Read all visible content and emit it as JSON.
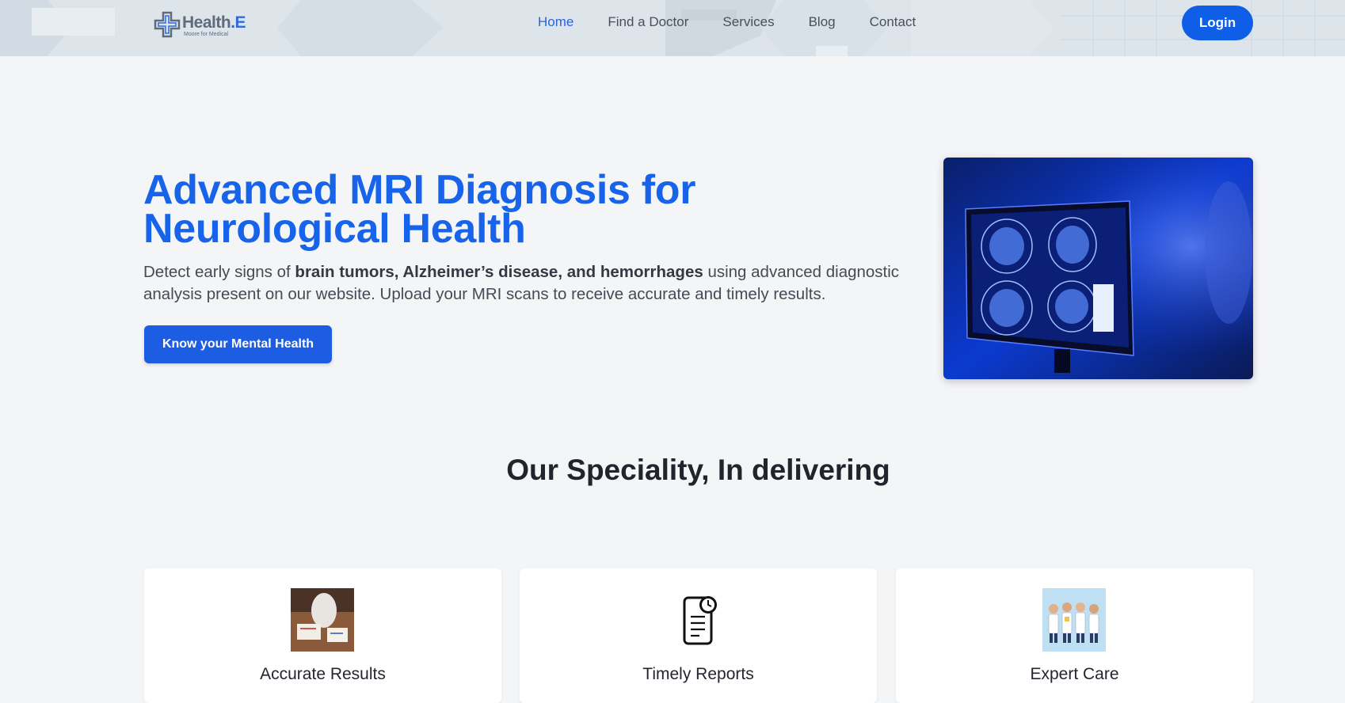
{
  "header": {
    "logo": {
      "name": "Health",
      "dot_e": ".E",
      "tagline": "Moore for Medical"
    },
    "nav": [
      {
        "label": "Home",
        "active": true
      },
      {
        "label": "Find a Doctor",
        "active": false
      },
      {
        "label": "Services",
        "active": false
      },
      {
        "label": "Blog",
        "active": false
      },
      {
        "label": "Contact",
        "active": false
      }
    ],
    "login_label": "Login"
  },
  "hero": {
    "title": "Advanced MRI Diagnosis for Neurological Health",
    "desc_pre": "Detect early signs of ",
    "desc_bold": "brain tumors, Alzheimer’s disease, and hemorrhages",
    "desc_post": " using advanced diagnostic analysis present on our website. Upload your MRI scans to receive accurate and timely results.",
    "cta_label": "Know your Mental Health",
    "image_icon": "mri-monitor-photo"
  },
  "speciality": {
    "title": "Our Speciality, In delivering",
    "cards": [
      {
        "label": "Accurate Results",
        "icon": "doctor-desk-photo"
      },
      {
        "label": "Timely Reports",
        "icon": "report-clock-icon"
      },
      {
        "label": "Expert Care",
        "icon": "doctors-team-illustration"
      }
    ]
  },
  "colors": {
    "primary": "#1763e9",
    "login": "#0e5ee8",
    "cta": "#1d5de4"
  }
}
